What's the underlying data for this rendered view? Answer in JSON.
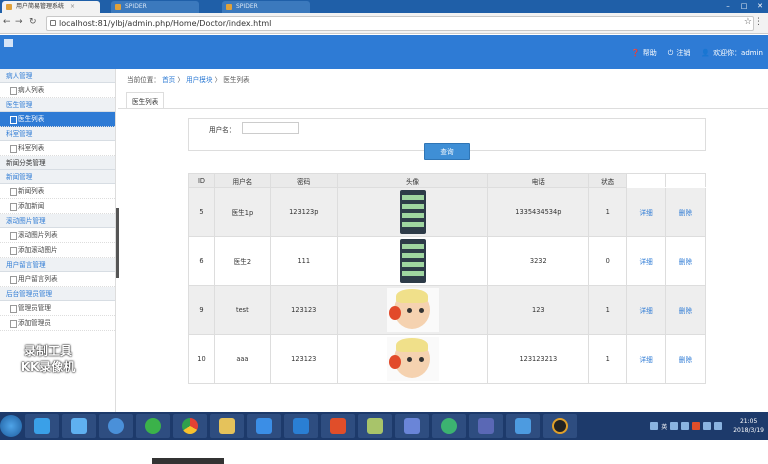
{
  "browser": {
    "tabs": [
      {
        "label": "用户简易管理系统",
        "active": true
      },
      {
        "label": "SPIDER",
        "active": false
      },
      {
        "label": "SPIDER",
        "active": false
      }
    ],
    "url": "localhost:81/ylbj/admin.php/Home/Doctor/index.html"
  },
  "header": {
    "links": [
      {
        "icon": "help-icon",
        "label": "帮助"
      },
      {
        "icon": "logout-icon",
        "label": "注销"
      },
      {
        "icon": "user-icon",
        "label": "欢迎你：admin"
      }
    ]
  },
  "sidebar": {
    "sections": [
      {
        "title": "病人管理",
        "items": [
          "病人列表"
        ]
      },
      {
        "title": "医生管理",
        "items": [
          "医生列表"
        ]
      },
      {
        "title": "科室管理",
        "items": [
          "科室列表"
        ]
      },
      {
        "title": "新闻分类管理",
        "items": []
      },
      {
        "title": "新闻管理",
        "items": [
          "新闻列表",
          "添加新闻"
        ]
      },
      {
        "title": "滚动图片管理",
        "items": [
          "滚动图片列表",
          "添加滚动图片"
        ]
      },
      {
        "title": "用户留言管理",
        "items": [
          "用户留言列表"
        ]
      },
      {
        "title": "后台管理员管理",
        "items": [
          "管理员管理",
          "添加管理员"
        ]
      }
    ],
    "active_item": "医生列表"
  },
  "watermark": {
    "line1": "录制工具",
    "line2": "KK录像机"
  },
  "content": {
    "breadcrumb": {
      "prefix": "当前位置：",
      "home": "首页",
      "sep": "〉",
      "section": "用户模块",
      "current": "医生列表"
    },
    "subtab": "医生列表",
    "search": {
      "label": "用户名：",
      "value": "",
      "button": "查询"
    },
    "table": {
      "headers": [
        "ID",
        "用户名",
        "密码",
        "头像",
        "电话",
        "状态",
        "",
        ""
      ],
      "rows": [
        {
          "id": "5",
          "name": "医生1p",
          "password": "123123p",
          "avatar": "phone-screenshot",
          "phone": "1335434534p",
          "status": "1",
          "detail": "详细",
          "delete": "删除"
        },
        {
          "id": "6",
          "name": "医生2",
          "password": "111",
          "avatar": "phone-screenshot",
          "phone": "3232",
          "status": "0",
          "detail": "详细",
          "delete": "删除"
        },
        {
          "id": "9",
          "name": "test",
          "password": "123123",
          "avatar": "cartoon-face",
          "phone": "123",
          "status": "1",
          "detail": "详细",
          "delete": "删除"
        },
        {
          "id": "10",
          "name": "aaa",
          "password": "123123",
          "avatar": "cartoon-face",
          "phone": "123123213",
          "status": "1",
          "detail": "详细",
          "delete": "删除"
        }
      ]
    }
  },
  "taskbar": {
    "clock_time": "21:05",
    "clock_date": "2018/3/19",
    "ime": "英"
  },
  "colors": {
    "accent": "#2e7bd5",
    "taskbar": "#1d3a6b"
  }
}
